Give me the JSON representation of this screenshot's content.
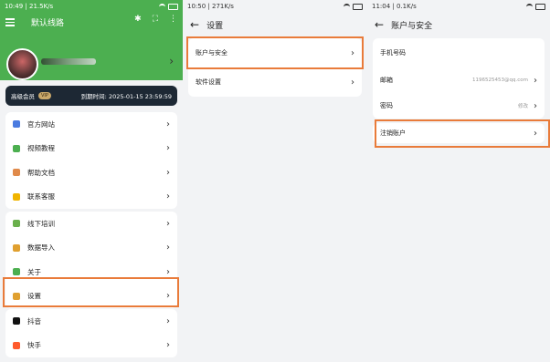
{
  "panel1": {
    "status": {
      "time": "10:49",
      "speed": "21.5K/s"
    },
    "app_title": "默认线路",
    "vip": {
      "label": "高级会员",
      "badge": "VIP",
      "expire_label": "到期时间:",
      "expire_date": "2025-01-15 23:59:59"
    },
    "group1": [
      {
        "label": "官方网站",
        "icon": "globe-icon",
        "color": "#4a7be0"
      },
      {
        "label": "视频教程",
        "icon": "video-icon",
        "color": "#4caf50"
      },
      {
        "label": "帮助文档",
        "icon": "document-icon",
        "color": "#e08a4a"
      },
      {
        "label": "联系客服",
        "icon": "support-icon",
        "color": "#f0b400"
      }
    ],
    "group2": [
      {
        "label": "线下培训",
        "icon": "training-icon",
        "color": "#6ab04c"
      },
      {
        "label": "数据导入",
        "icon": "import-icon",
        "color": "#e0a030"
      },
      {
        "label": "关于",
        "icon": "info-icon",
        "color": "#4caf50"
      },
      {
        "label": "设置",
        "icon": "gear-icon",
        "color": "#e0a030"
      }
    ],
    "group3": [
      {
        "label": "抖音",
        "icon": "douyin-icon",
        "color": "#111111"
      },
      {
        "label": "快手",
        "icon": "kuaishou-icon",
        "color": "#ff5a2c"
      }
    ]
  },
  "panel2": {
    "status": {
      "time": "10:50",
      "speed": "271K/s"
    },
    "title": "设置",
    "items": [
      {
        "label": "账户与安全"
      },
      {
        "label": "软件设置"
      }
    ]
  },
  "panel3": {
    "status": {
      "time": "11:04",
      "speed": "0.1K/s"
    },
    "title": "账户与安全",
    "phone_label": "手机号码",
    "email_label": "邮箱",
    "email_value": "1196525453@qq.com",
    "password_label": "密码",
    "password_action": "修改",
    "delete_label": "注销账户"
  },
  "colors": {
    "brand_green": "#4caf50",
    "highlight": "#e97b3a",
    "vip_bar": "#1d2834"
  }
}
